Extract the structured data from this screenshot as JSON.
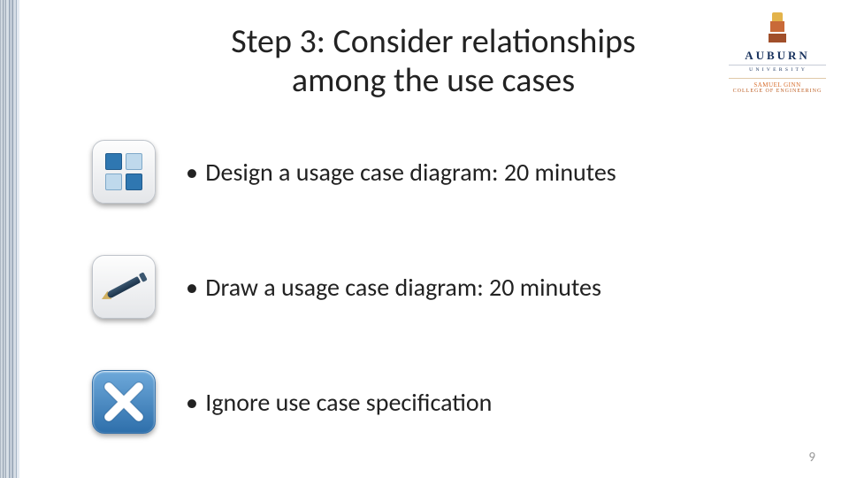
{
  "title_line1": "Step 3: Consider relationships",
  "title_line2": "among the use cases",
  "university": "AUBURN",
  "univ_sub": "U N I V E R S I T Y",
  "college_line1": "SAMUEL GINN",
  "college_line2": "COLLEGE OF ENGINEERING",
  "bullets": [
    "Design a usage case diagram: 20 minutes",
    "Draw a usage case diagram: 20 minutes",
    "Ignore use case specification"
  ],
  "page_number": "9"
}
